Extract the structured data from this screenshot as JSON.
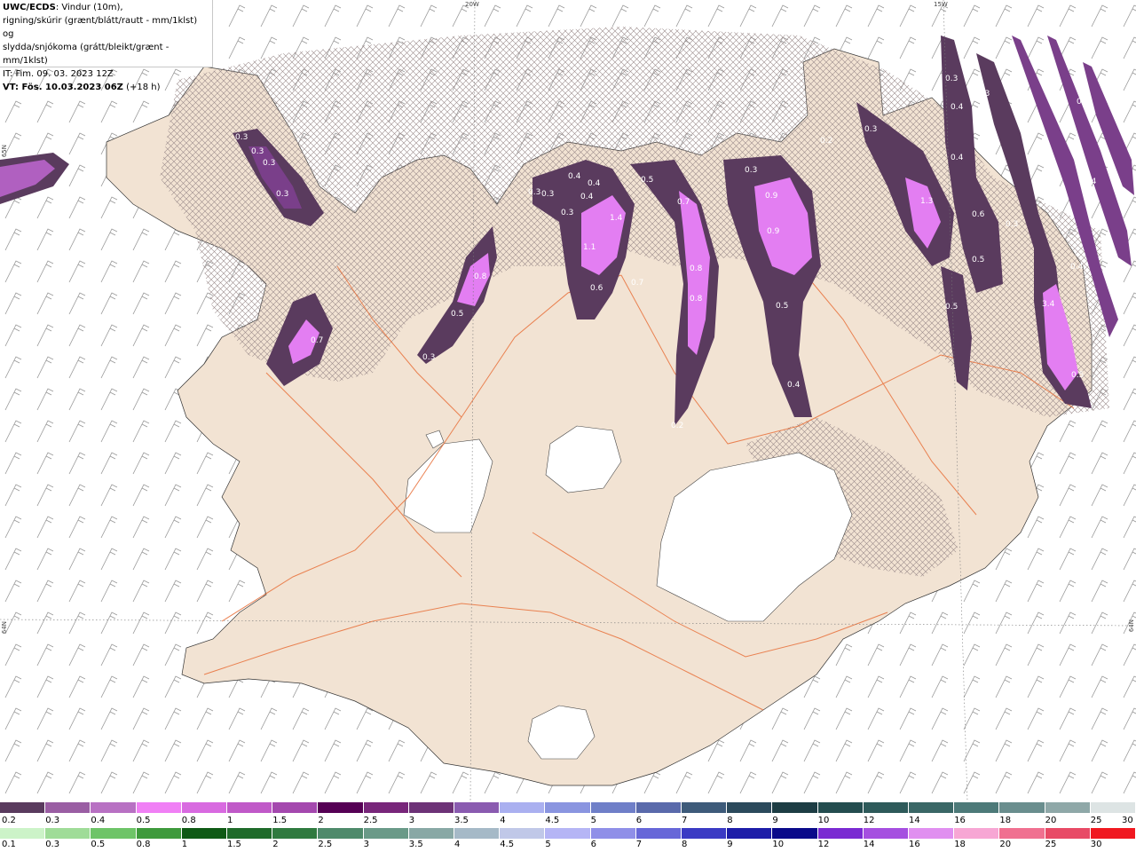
{
  "info": {
    "title": "UWC/ECDS",
    "line1": ": Vindur (10m),",
    "line2": "rigning/skúrir (grænt/blátt/rautt - mm/1klst) og",
    "line3": "slydda/snjókoma (grátt/bleikt/grænt - mm/1klst)",
    "it": "IT: Fim. 09. 03. 2023 12Z",
    "vt_label": "VT: Fös. 10.03.2023 06Z",
    "vt_offset": " (+18 h)"
  },
  "coords": {
    "lon20": "20W",
    "lon15": "15W",
    "lat65_left": "65N",
    "lat64_left": "64N",
    "lat64_right": "64N"
  },
  "map_colors": {
    "land": "#f2e3d3",
    "sea": "#ffffff",
    "roads": "#e8703a",
    "snow": "#c89ad6",
    "snow_mid": "#7a3f8a",
    "snow_hi": "#e37ef2",
    "hatch": "#9b8b8b",
    "glacier": "#ffffff"
  },
  "precip_labels": [
    "0.3",
    "0.3",
    "0.3",
    "0.3",
    "0.7",
    "0.8",
    "0.5",
    "0.3",
    "0.3",
    "0.3",
    "0.4",
    "0.4",
    "0.4",
    "0.3",
    "1.4",
    "1.1",
    "0.6",
    "0.7",
    "0.5",
    "0.7",
    "0.8",
    "0.8",
    "0.3",
    "0.9",
    "0.9",
    "0.5",
    "0.4",
    "0.2",
    "0.2",
    "0.3",
    "1.3",
    "0.6",
    "0.3",
    "0.5",
    "0.5",
    "0.3",
    "0.4",
    "0.3",
    "0.4",
    "0.3",
    "0.4",
    "0.4",
    "0.4",
    "0.4",
    "0.4",
    "3.4",
    "0.5"
  ],
  "legend_top": {
    "labels": [
      "0.2",
      "0.3",
      "0.4",
      "0.5",
      "0.8",
      "1",
      "1.5",
      "2",
      "2.5",
      "3",
      "3.5",
      "4",
      "4.5",
      "5",
      "6",
      "7",
      "8",
      "9",
      "10",
      "12",
      "14",
      "16",
      "18",
      "20",
      "25",
      "30"
    ],
    "colors": [
      "#5a3b5e",
      "#9a5ea3",
      "#b871c3",
      "#f080f5",
      "#d86ae0",
      "#c059c8",
      "#a448ae",
      "#560055",
      "#78267a",
      "#6d3277",
      "#8a5bb0",
      "#aab0f0",
      "#8a95e0",
      "#6f7fc8",
      "#5a6aab",
      "#3e5b7a",
      "#2c4a5c",
      "#1d3d44",
      "#244d4f",
      "#2e5a5a",
      "#3a6766",
      "#4d7a79",
      "#6a8e8e",
      "#8fa8a8",
      "#dde4e4"
    ]
  },
  "legend_bottom": {
    "labels": [
      "0.1",
      "0.3",
      "0.5",
      "0.8",
      "1",
      "1.5",
      "2",
      "2.5",
      "3",
      "3.5",
      "4",
      "4.5",
      "5",
      "6",
      "7",
      "8",
      "9",
      "10",
      "12",
      "14",
      "16",
      "18",
      "20",
      "25",
      "30"
    ],
    "colors": [
      "#ccf3c8",
      "#9fdc98",
      "#6ec468",
      "#3e9a3c",
      "#0f5a15",
      "#1f6b2a",
      "#2f7a3f",
      "#4e8a6b",
      "#6a9a88",
      "#88a8a5",
      "#a5b9c7",
      "#c0c8e8",
      "#b5b5f5",
      "#8f8fe8",
      "#6767d8",
      "#3b3bc4",
      "#1d1da8",
      "#0a0a8a",
      "#7a2ad2",
      "#a54fe0",
      "#e08ff0",
      "#f7a6d4",
      "#f07090",
      "#e84a66",
      "#f01820"
    ]
  }
}
